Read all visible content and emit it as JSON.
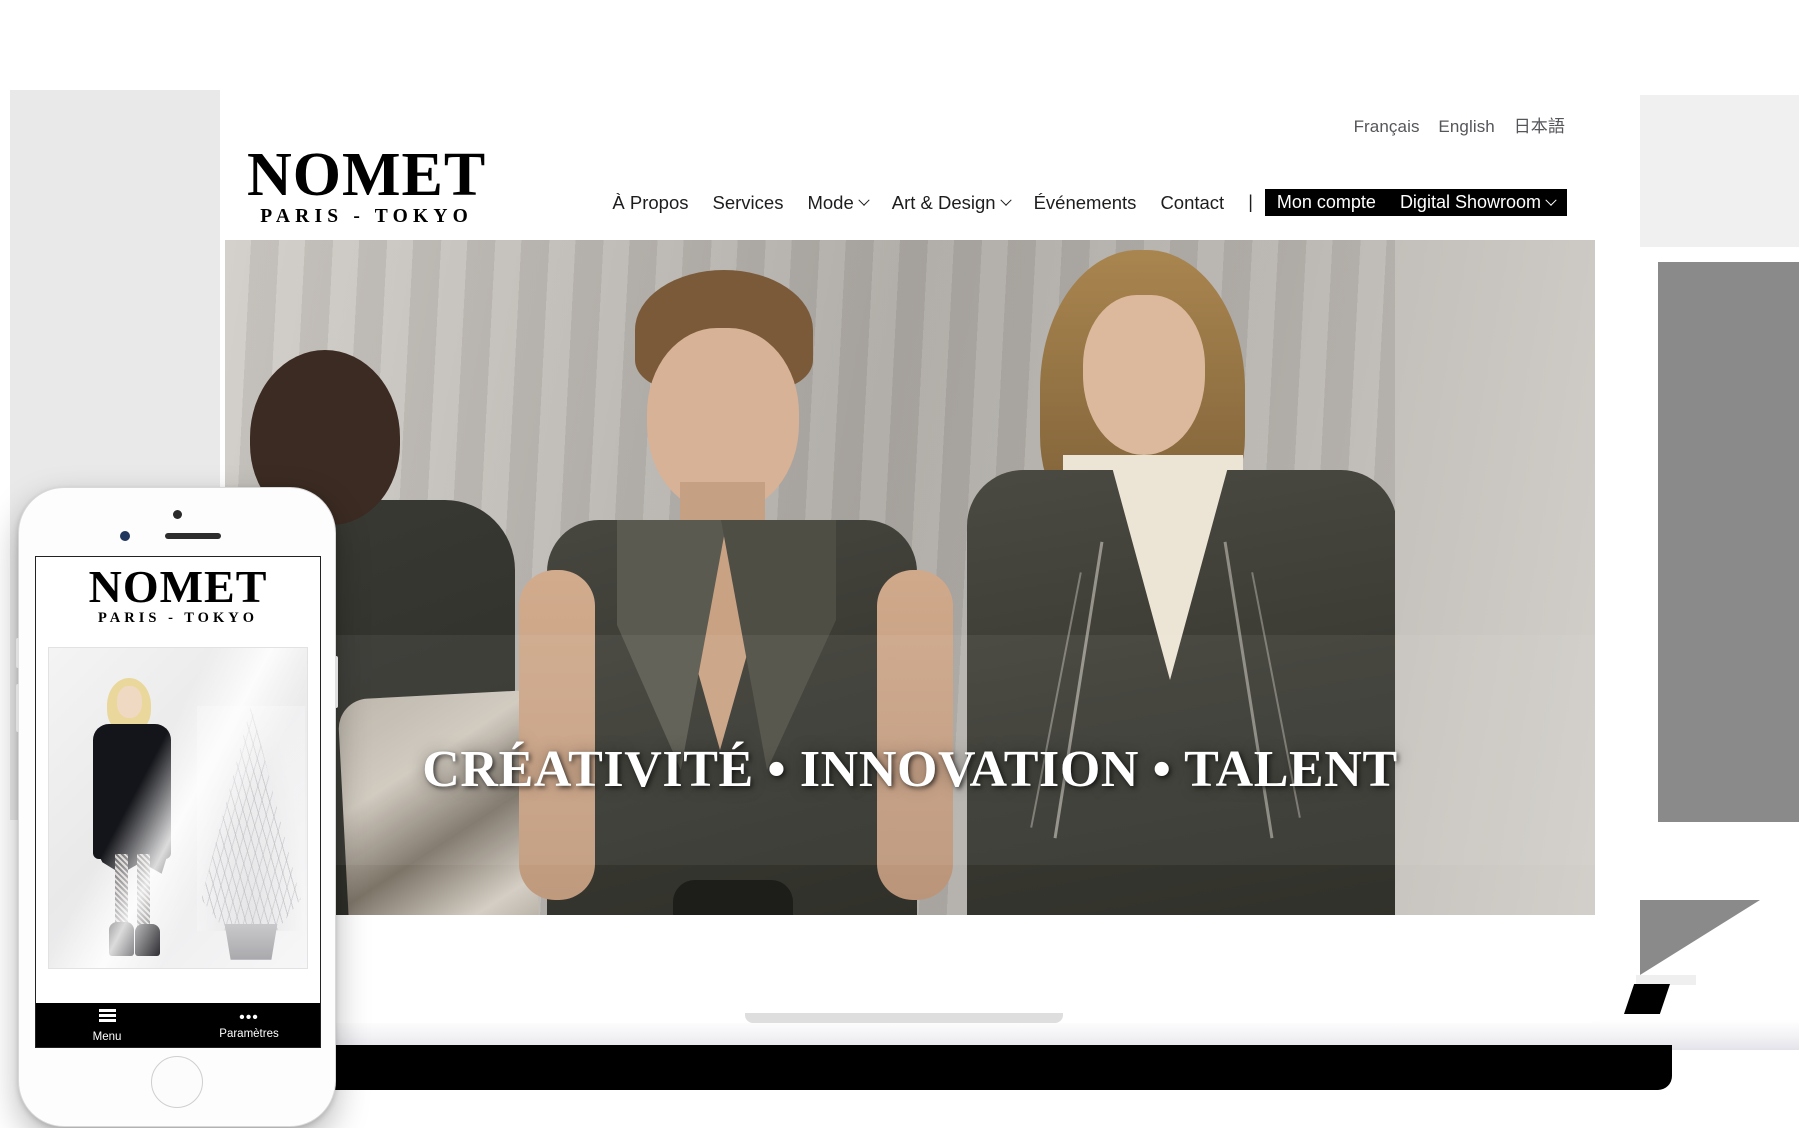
{
  "brand": {
    "name": "NOMET",
    "tagline": "PARIS - TOKYO"
  },
  "languages": [
    {
      "label": "Français",
      "code": "fr"
    },
    {
      "label": "English",
      "code": "en"
    },
    {
      "label": "日本語",
      "code": "ja"
    }
  ],
  "nav": {
    "items": [
      {
        "label": "À Propos",
        "has_dropdown": false
      },
      {
        "label": "Services",
        "has_dropdown": false
      },
      {
        "label": "Mode",
        "has_dropdown": true
      },
      {
        "label": "Art & Design",
        "has_dropdown": true
      },
      {
        "label": "Événements",
        "has_dropdown": false
      },
      {
        "label": "Contact",
        "has_dropdown": false
      }
    ],
    "separator": "|",
    "dark_items": [
      {
        "label": "Mon compte",
        "has_dropdown": false
      },
      {
        "label": "Digital Showroom",
        "has_dropdown": true
      }
    ]
  },
  "hero": {
    "title": "CRÉATIVITÉ • INNOVATION • TALENT"
  },
  "phone": {
    "brand": "NOMET",
    "tagline": "PARIS - TOKYO",
    "tabs": [
      {
        "label": "Menu",
        "icon": "hamburger-icon"
      },
      {
        "label": "Paramètres",
        "icon": "ellipsis-icon"
      }
    ]
  },
  "colors": {
    "accent_dark": "#000000",
    "text": "#1d1d1f",
    "muted": "#55565a",
    "page_bg": "#ffffff"
  }
}
